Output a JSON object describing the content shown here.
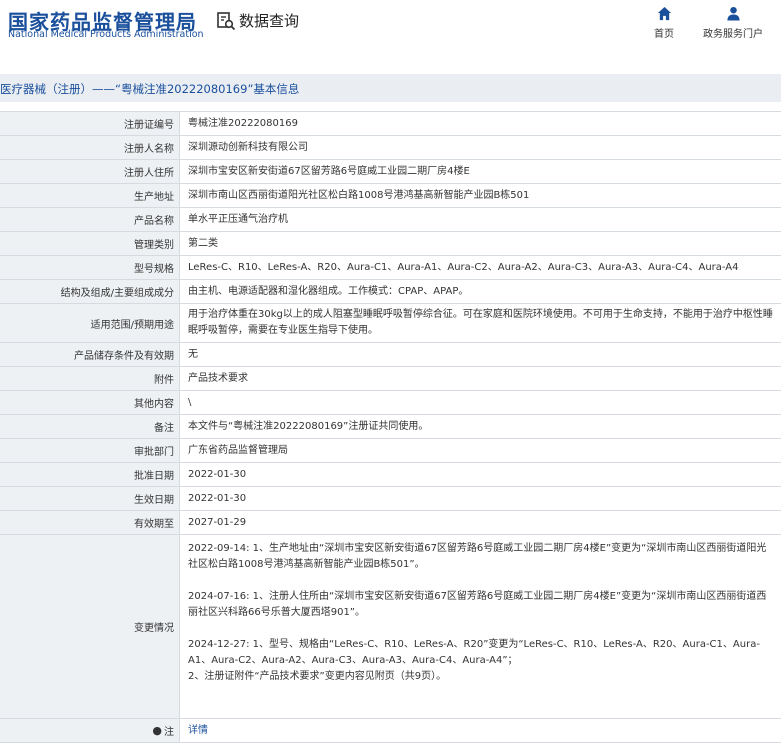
{
  "header": {
    "logo_cn": "国家药品监督管理局",
    "logo_en": "National Medical Products Administration",
    "query_label": "数据查询",
    "nav": {
      "home": "首页",
      "portal": "政务服务门户"
    }
  },
  "colors": {
    "brand": "#1a4f9c",
    "label_bg": "#eef1f4",
    "titlebar_bg": "#eaeef3",
    "border": "#d6dbe1"
  },
  "breadcrumb": "医疗器械（注册）——“粤械注准20222080169”基本信息",
  "fields": [
    {
      "label": "注册证编号",
      "value": "粤械注准20222080169"
    },
    {
      "label": "注册人名称",
      "value": "深圳源动创新科技有限公司"
    },
    {
      "label": "注册人住所",
      "value": "深圳市宝安区新安街道67区留芳路6号庭威工业园二期厂房4楼E"
    },
    {
      "label": "生产地址",
      "value": "深圳市南山区西丽街道阳光社区松白路1008号港鸿基高新智能产业园B栋501"
    },
    {
      "label": "产品名称",
      "value": "单水平正压通气治疗机"
    },
    {
      "label": "管理类别",
      "value": "第二类"
    },
    {
      "label": "型号规格",
      "value": "LeRes-C、R10、LeRes-A、R20、Aura-C1、Aura-A1、Aura-C2、Aura-A2、Aura-C3、Aura-A3、Aura-C4、Aura-A4"
    },
    {
      "label": "结构及组成/主要组成成分",
      "value": "由主机、电源适配器和湿化器组成。工作模式：CPAP、APAP。"
    },
    {
      "label": "适用范围/预期用途",
      "value": "用于治疗体重在30kg以上的成人阻塞型睡眠呼吸暂停综合征。可在家庭和医院环境使用。不可用于生命支持，不能用于治疗中枢性睡眠呼吸暂停，需要在专业医生指导下使用。"
    },
    {
      "label": "产品储存条件及有效期",
      "value": "无"
    },
    {
      "label": "附件",
      "value": "产品技术要求"
    },
    {
      "label": "其他内容",
      "value": "\\"
    },
    {
      "label": "备注",
      "value": "本文件与“粤械注准20222080169”注册证共同使用。"
    },
    {
      "label": "审批部门",
      "value": "广东省药品监督管理局"
    },
    {
      "label": "批准日期",
      "value": "2022-01-30"
    },
    {
      "label": "生效日期",
      "value": "2022-01-30"
    },
    {
      "label": "有效期至",
      "value": "2027-01-29"
    }
  ],
  "changes": {
    "label": "变更情况",
    "entries": [
      "2022-09-14: 1、生产地址由“深圳市宝安区新安街道67区留芳路6号庭威工业园二期厂房4楼E”变更为“深圳市南山区西丽街道阳光社区松白路1008号港鸿基高新智能产业园B栋501”。",
      "2024-07-16: 1、注册人住所由“深圳市宝安区新安街道67区留芳路6号庭威工业园二期厂房4楼E”变更为“深圳市南山区西丽街道西丽社区兴科路66号乐普大厦西塔901”。",
      "2024-12-27: 1、型号、规格由“LeRes-C、R10、LeRes-A、R20”变更为“LeRes-C、R10、LeRes-A、R20、Aura-C1、Aura-A1、Aura-C2、Aura-A2、Aura-C3、Aura-A3、Aura-C4、Aura-A4”；",
      "2、注册证附件“产品技术要求”变更内容见附页（共9页）。"
    ]
  },
  "note": {
    "label": "注",
    "link": "详情"
  }
}
